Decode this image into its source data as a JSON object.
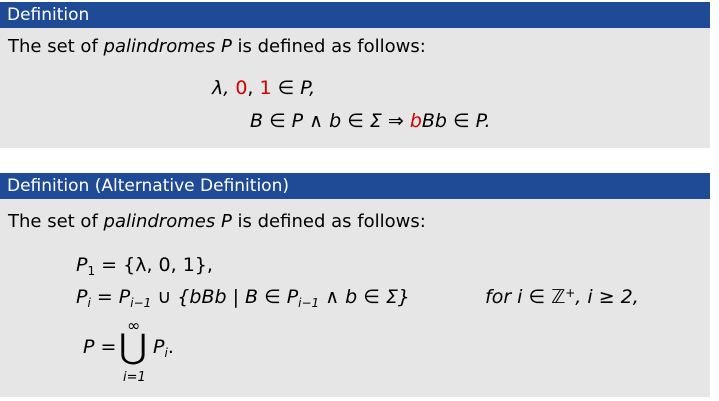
{
  "block1": {
    "title": "Definition",
    "intro_before": "The set of ",
    "intro_term": "palindromes",
    "intro_mid": " ",
    "intro_symbol": "P",
    "intro_after": " is defined as follows:",
    "line1_lambda": "λ, ",
    "line1_zero": "0",
    "line1_comma": ", ",
    "line1_one": "1",
    "line1_rest": " ∈ P,",
    "line2_left": "B ∈ P ∧ b ∈ Σ ⇒ ",
    "line2_b": "b",
    "line2_right": "Bb ∈ P."
  },
  "block2": {
    "title": "Definition (Alternative Definition)",
    "intro_before": "The set of ",
    "intro_term": "palindromes",
    "intro_mid": " ",
    "intro_symbol": "P",
    "intro_after": " is defined as follows:",
    "eq1_left": "P",
    "eq1_sub": "1",
    "eq1_right": " = {λ, 0, 1},",
    "eq2_left": "P",
    "eq2_sub": "i",
    "eq2_mid": " = P",
    "eq2_sub2": "i−1",
    "eq2_mid2": " ∪ {bBb | B ∈ P",
    "eq2_sub3": "i−1",
    "eq2_right": " ∧ b ∈ Σ}",
    "eq2_cond_before": "for i ∈ ℤ",
    "eq2_cond_sup": "+",
    "eq2_cond_after": ", i ≥ 2,",
    "eq3_left": "P =",
    "eq3_union": "⋃",
    "eq3_upper": "∞",
    "eq3_lower": "i=1",
    "eq3_right": "P",
    "eq3_sub": "i",
    "eq3_end": "."
  }
}
